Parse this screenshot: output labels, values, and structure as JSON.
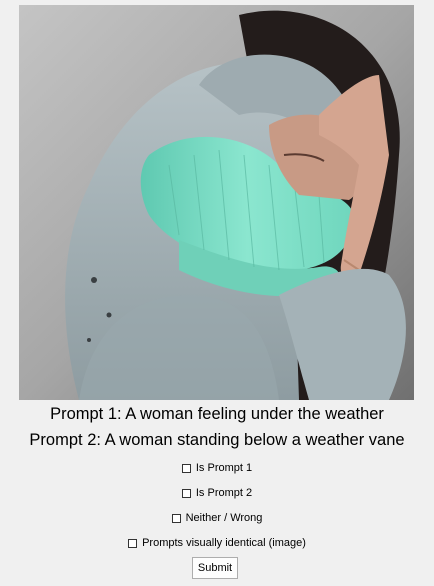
{
  "image": {
    "icon": "photo-woman-face-covered"
  },
  "prompts": {
    "prompt1": "Prompt 1: A woman feeling under the weather",
    "prompt2": "Prompt 2: A woman standing below a weather vane"
  },
  "options": [
    {
      "label": "Is Prompt 1",
      "checked": false
    },
    {
      "label": "Is Prompt 2",
      "checked": false
    },
    {
      "label": "Neither / Wrong",
      "checked": false
    },
    {
      "label": "Prompts visually identical (image)",
      "checked": false
    }
  ],
  "submit_label": "Submit",
  "colors": {
    "window_bg": "#f0f0f0",
    "scarf": "#7fdcc5",
    "hoodie": "#a7b4b8",
    "hair": "#2a2221"
  }
}
